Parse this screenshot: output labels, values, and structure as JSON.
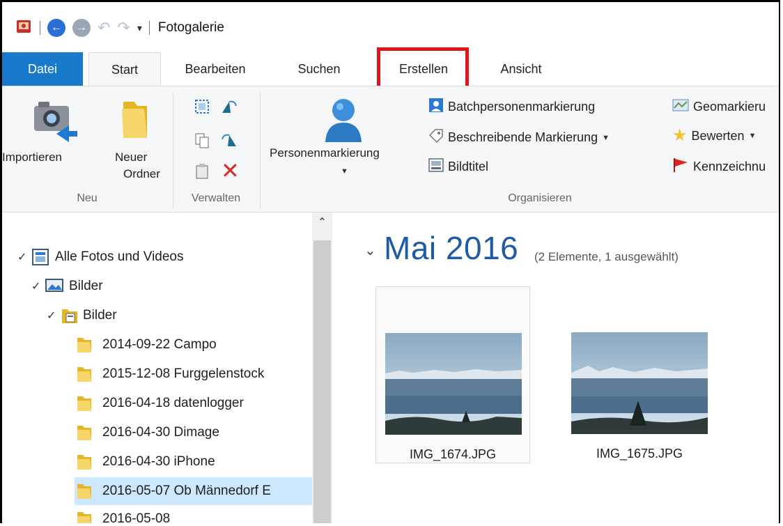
{
  "window": {
    "title": "Fotogalerie"
  },
  "tabs": [
    {
      "label": "Datei"
    },
    {
      "label": "Start"
    },
    {
      "label": "Bearbeiten"
    },
    {
      "label": "Suchen"
    },
    {
      "label": "Erstellen"
    },
    {
      "label": "Ansicht"
    }
  ],
  "ribbon": {
    "neu": {
      "label": "Neu",
      "import_label": "Importieren",
      "new_folder_line1": "Neuer",
      "new_folder_line2": "Ordner"
    },
    "verwalten": {
      "label": "Verwalten"
    },
    "organisieren": {
      "label": "Organisieren",
      "people_tag": "Personenmarkierung",
      "batch_people": "Batchpersonenmarkierung",
      "descriptive_tag": "Beschreibende Markierung",
      "caption": "Bildtitel",
      "geotag": "Geomarkieru",
      "rate": "Bewerten",
      "flag": "Kennzeichnu"
    }
  },
  "nav": {
    "items": [
      {
        "label": "Alle Fotos und Videos"
      },
      {
        "label": "Bilder"
      },
      {
        "label": "Bilder"
      },
      {
        "label": "2014-09-22 Campo"
      },
      {
        "label": "2015-12-08 Furggelenstock"
      },
      {
        "label": "2016-04-18 datenlogger"
      },
      {
        "label": "2016-04-30 Dimage"
      },
      {
        "label": "2016-04-30 iPhone"
      },
      {
        "label": "2016-05-07 Ob Männedorf E"
      },
      {
        "label": "2016-05-08"
      }
    ]
  },
  "content": {
    "group_title": "Mai 2016",
    "group_count": "(2 Elemente, 1 ausgewählt)",
    "photos": [
      {
        "name": "IMG_1674.JPG",
        "selected": true
      },
      {
        "name": "IMG_1675.JPG",
        "selected": false
      }
    ]
  },
  "colors": {
    "accent": "#1979ca",
    "highlight": "#e1141b",
    "title_blue": "#1e5aa6",
    "selected_row": "#cce8ff"
  }
}
